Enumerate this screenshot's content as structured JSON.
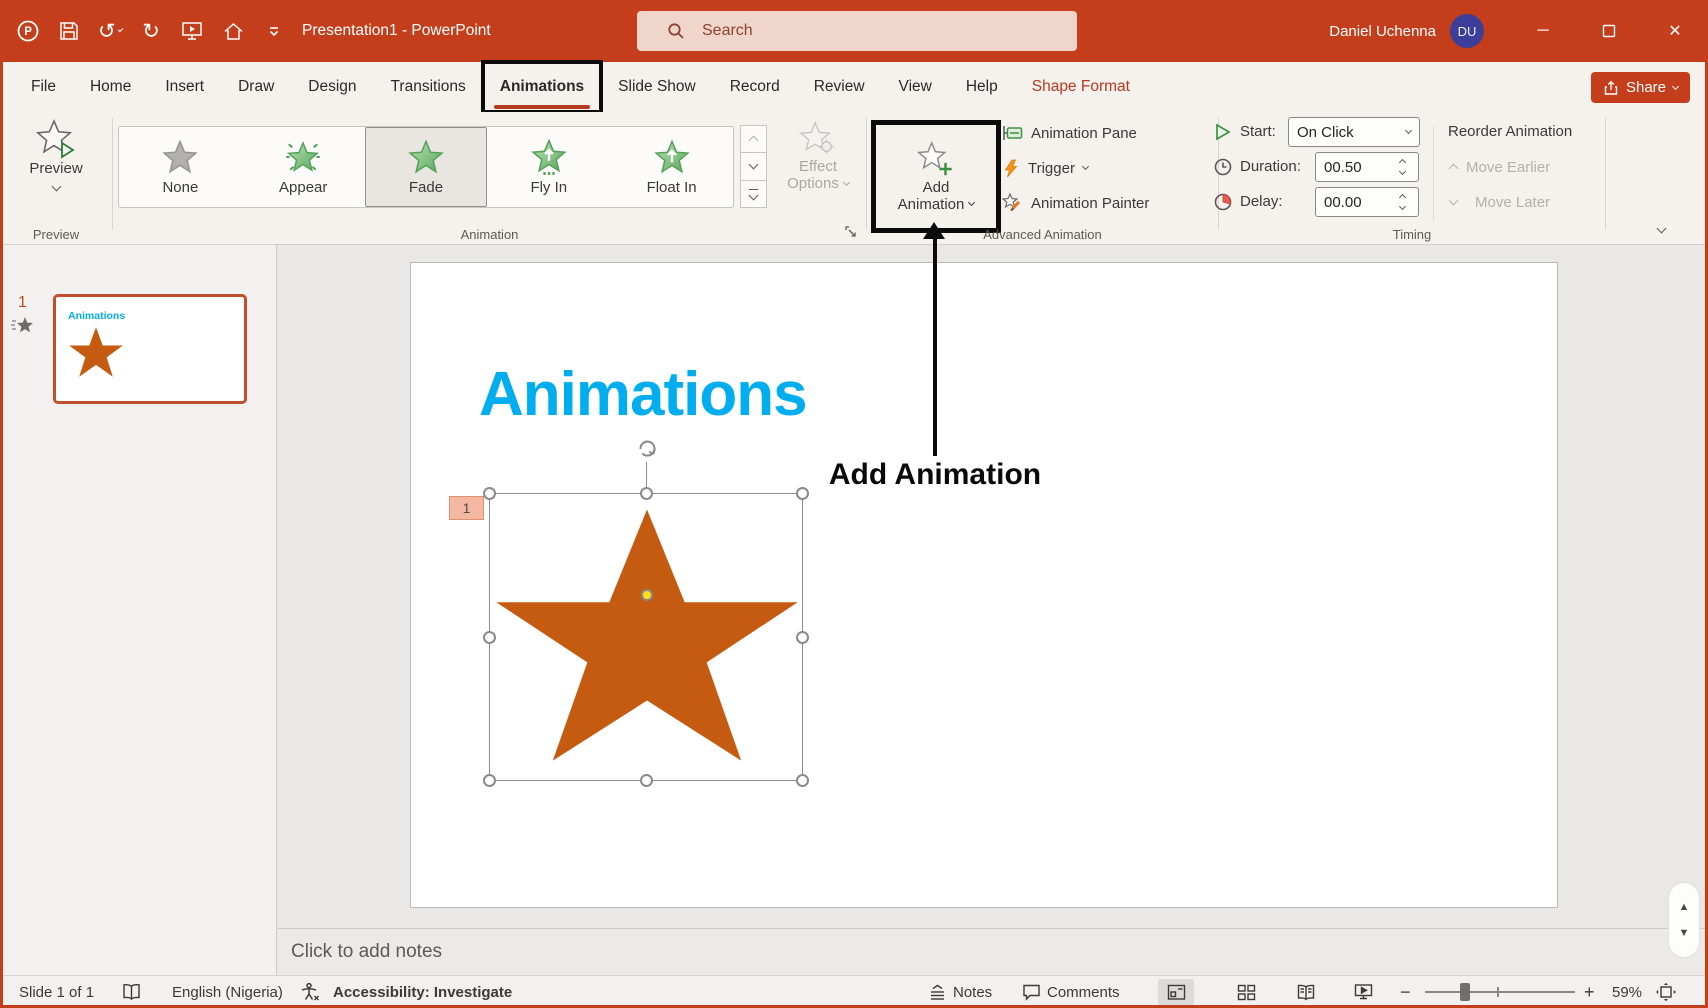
{
  "titlebar": {
    "title": "Presentation1 - PowerPoint",
    "search_placeholder": "Search",
    "user_name": "Daniel Uchenna",
    "user_initials": "DU"
  },
  "tabs": {
    "items": [
      "File",
      "Home",
      "Insert",
      "Draw",
      "Design",
      "Transitions",
      "Animations",
      "Slide Show",
      "Record",
      "Review",
      "View",
      "Help",
      "Shape Format"
    ],
    "active": "Animations",
    "share_label": "Share"
  },
  "ribbon": {
    "preview_group": {
      "button": "Preview",
      "group_label": "Preview"
    },
    "animation_group": {
      "group_label": "Animation",
      "gallery": [
        {
          "label": "None"
        },
        {
          "label": "Appear"
        },
        {
          "label": "Fade"
        },
        {
          "label": "Fly In"
        },
        {
          "label": "Float In"
        }
      ],
      "selected_effect": "Fade",
      "effect_line1": "Effect",
      "effect_line2": "Options"
    },
    "advanced_group": {
      "group_label": "Advanced Animation",
      "add_line1": "Add",
      "add_line2": "Animation",
      "pane": "Animation Pane",
      "trigger": "Trigger",
      "painter": "Animation Painter"
    },
    "timing_group": {
      "group_label": "Timing",
      "start_label": "Start:",
      "start_value": "On Click",
      "duration_label": "Duration:",
      "duration_value": "00.50",
      "delay_label": "Delay:",
      "delay_value": "00.00",
      "reorder_label": "Reorder Animation",
      "move_earlier": "Move Earlier",
      "move_later": "Move Later"
    }
  },
  "slide_panel": {
    "slide_number": "1",
    "thumb_title": "Animations"
  },
  "canvas": {
    "slide_title": "Animations",
    "animation_badge": "1"
  },
  "annotation": {
    "label": "Add Animation"
  },
  "notes": {
    "placeholder": "Click to add notes"
  },
  "statusbar": {
    "slide_indicator": "Slide 1 of 1",
    "language": "English (Nigeria)",
    "accessibility": "Accessibility: Investigate",
    "notes_label": "Notes",
    "comments_label": "Comments",
    "zoom_percent": "59%"
  },
  "colors": {
    "accent": "#C43E1C",
    "slide_title_blue": "#00AEEF",
    "star_orange": "#C55A11",
    "animation_green": "#5FAF5F"
  }
}
